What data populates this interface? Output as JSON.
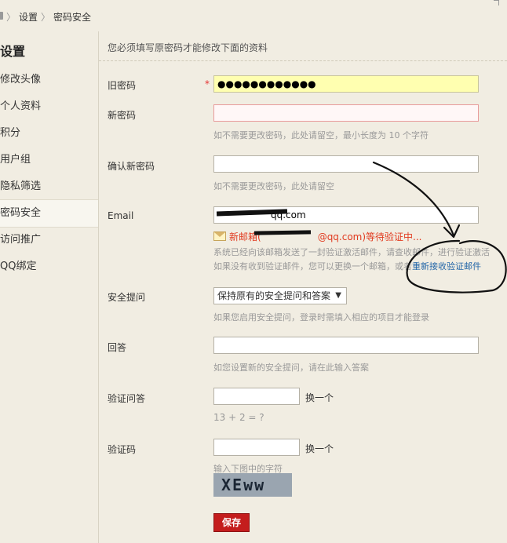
{
  "breadcrumb": {
    "items": [
      "设置",
      "密码安全"
    ],
    "separator": "〉"
  },
  "sidebar": {
    "title": "设置",
    "items": [
      {
        "label": "修改头像"
      },
      {
        "label": "个人资料"
      },
      {
        "label": "积分"
      },
      {
        "label": "用户组"
      },
      {
        "label": "隐私筛选"
      },
      {
        "label": "密码安全",
        "active": true
      },
      {
        "label": "访问推广"
      },
      {
        "label": "QQ绑定"
      }
    ]
  },
  "form": {
    "notice": "您必须填写原密码才能修改下面的资料",
    "old_password": {
      "label": "旧密码",
      "required": "*",
      "value": "●●●●●●●●●●●●"
    },
    "new_password": {
      "label": "新密码",
      "value": "",
      "hint": "如不需要更改密码，此处请留空，最小长度为 10 个字符"
    },
    "confirm_password": {
      "label": "确认新密码",
      "value": "",
      "hint": "如不需要更改密码，此处请留空"
    },
    "email": {
      "label": "Email",
      "value": "qq.com",
      "warning_prefix": "新邮箱(",
      "warning_suffix": "@qq.com)等待验证中...",
      "info_line1": "系统已经向该邮箱发送了一封验证激活邮件，请查收邮件，进行验证激活",
      "info_line2_prefix": "如果没有收到验证邮件，您可以更换一个邮箱，或者",
      "resend_link": "重新接收验证邮件"
    },
    "security_question": {
      "label": "安全提问",
      "selected": "保持原有的安全提问和答案",
      "hint": "如果您启用安全提问，登录时需填入相应的项目才能登录"
    },
    "answer": {
      "label": "回答",
      "value": "",
      "hint": "如您设置新的安全提问，请在此输入答案"
    },
    "verify_question": {
      "label": "验证问答",
      "value": "",
      "change": "换一个",
      "question": "13 + 2 = ?"
    },
    "captcha": {
      "label": "验证码",
      "value": "",
      "change": "换一个",
      "hint": "输入下图中的字符",
      "image_text": "XEww"
    },
    "save_label": "保存"
  },
  "colors": {
    "accent": "#c41d1d",
    "link": "#2366a8",
    "warning": "#e13a1f"
  },
  "icons": [
    "home-icon",
    "mail-icon",
    "dropdown-arrow-icon"
  ]
}
